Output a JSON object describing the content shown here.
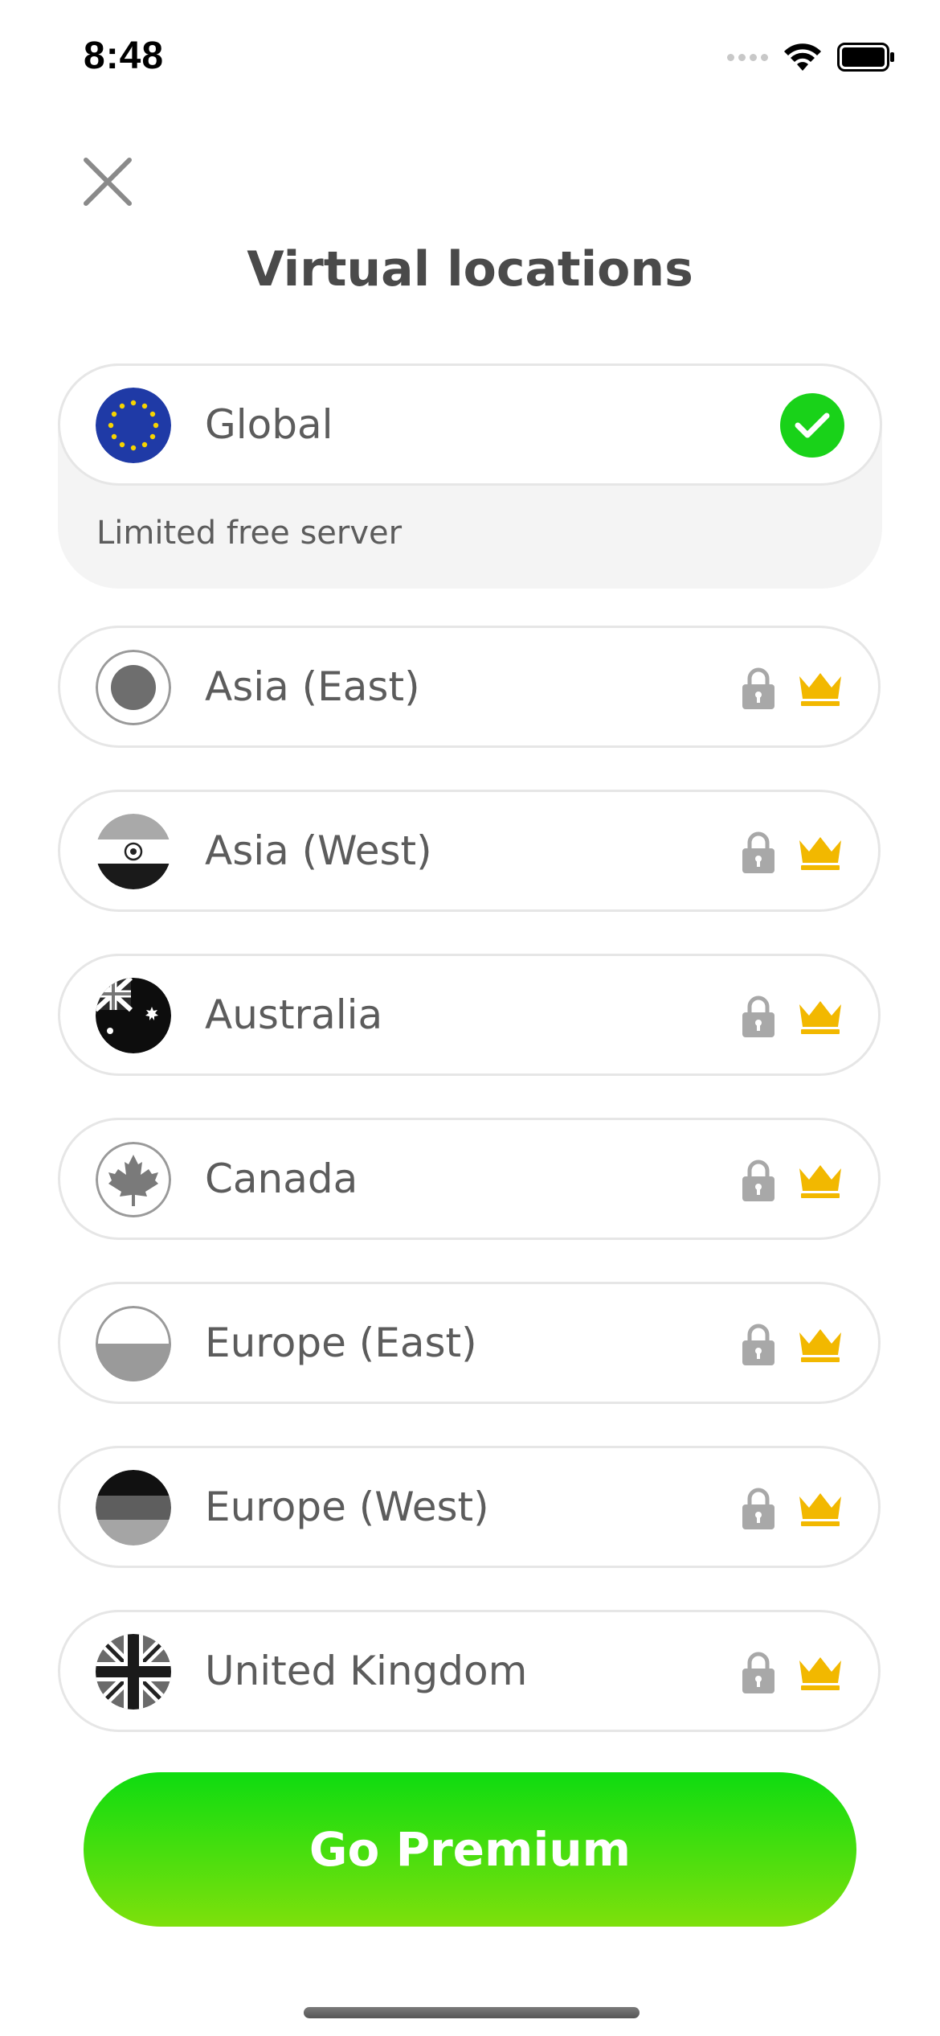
{
  "status_bar": {
    "time": "8:48"
  },
  "header": {
    "title": "Virtual locations",
    "close_icon": "close-icon"
  },
  "global": {
    "label": "Global",
    "subtitle": "Limited free server",
    "selected": true,
    "check_color": "#19d219"
  },
  "locations": [
    {
      "label": "Asia (East)",
      "locked": true,
      "premium": true
    },
    {
      "label": "Asia (West)",
      "locked": true,
      "premium": true
    },
    {
      "label": "Australia",
      "locked": true,
      "premium": true
    },
    {
      "label": "Canada",
      "locked": true,
      "premium": true
    },
    {
      "label": "Europe (East)",
      "locked": true,
      "premium": true
    },
    {
      "label": "Europe (West)",
      "locked": true,
      "premium": true
    },
    {
      "label": "United Kingdom",
      "locked": true,
      "premium": true
    }
  ],
  "cta": {
    "label": "Go Premium",
    "gradient_top": "#0edc10",
    "gradient_bottom": "#7ee00c"
  },
  "colors": {
    "crown": "#f2b800",
    "lock": "#a8a8a8",
    "text": "#5c5c5c"
  }
}
